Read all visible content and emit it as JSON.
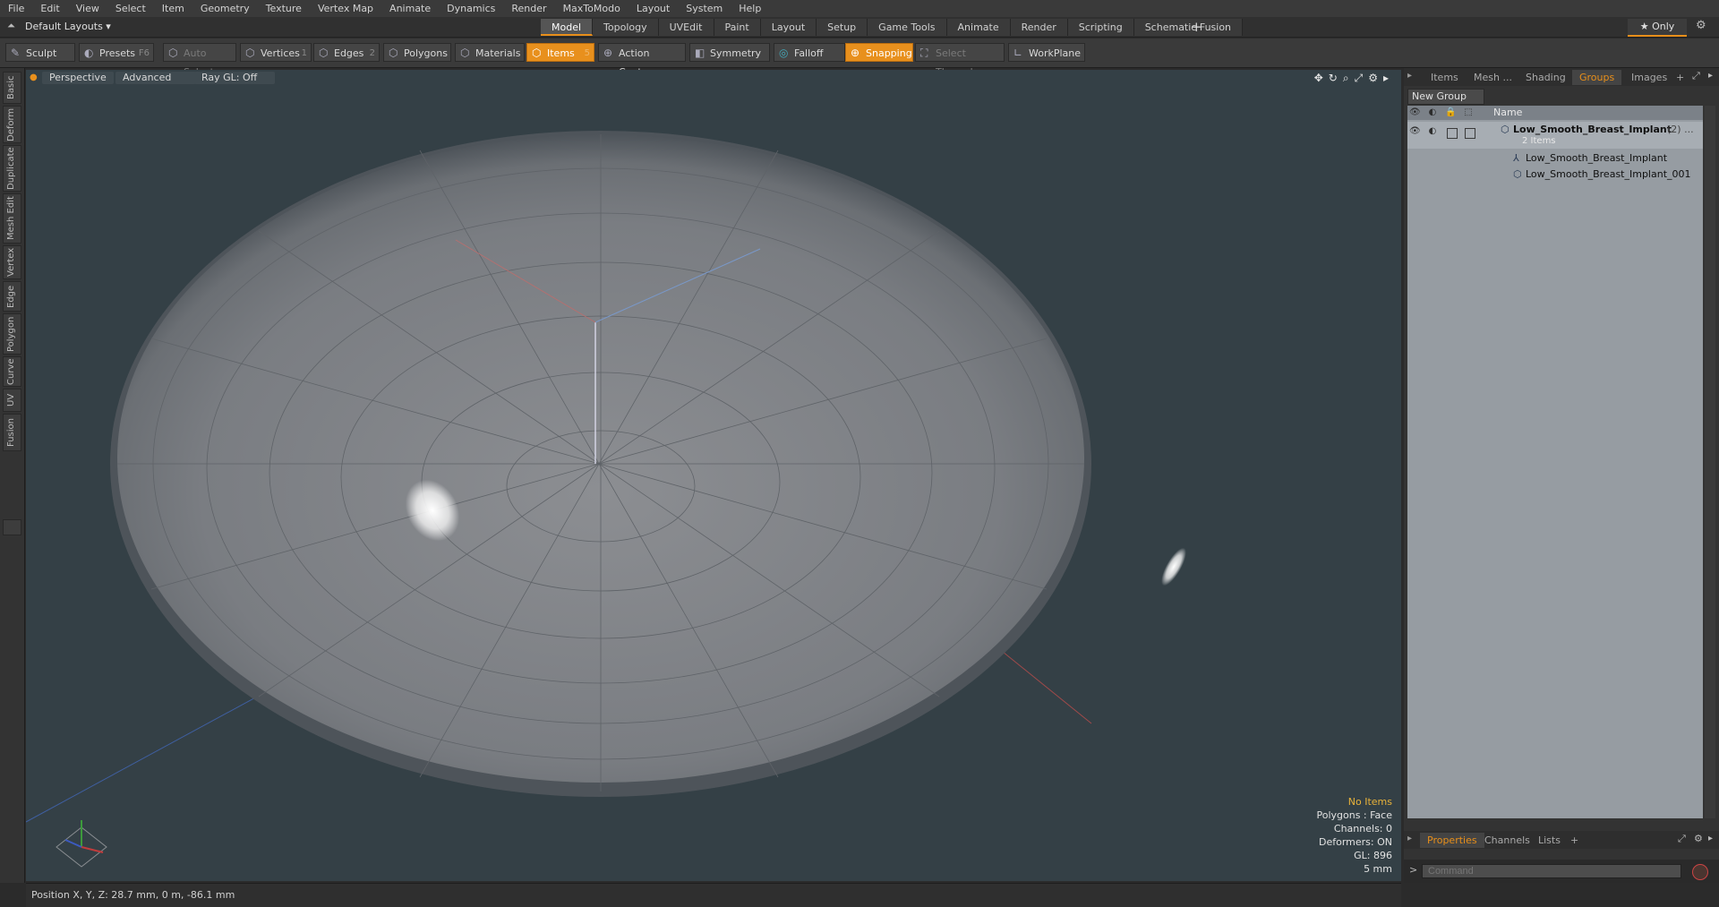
{
  "menu": [
    "File",
    "Edit",
    "View",
    "Select",
    "Item",
    "Geometry",
    "Texture",
    "Vertex Map",
    "Animate",
    "Dynamics",
    "Render",
    "MaxToModo",
    "Layout",
    "System",
    "Help"
  ],
  "layout_selector": "Default Layouts ▾",
  "tabs": [
    {
      "label": "Model",
      "active": true
    },
    {
      "label": "Topology",
      "active": false
    },
    {
      "label": "UVEdit",
      "active": false
    },
    {
      "label": "Paint",
      "active": false
    },
    {
      "label": "Layout",
      "active": false
    },
    {
      "label": "Setup",
      "active": false
    },
    {
      "label": "Game Tools",
      "active": false
    },
    {
      "label": "Animate",
      "active": false
    },
    {
      "label": "Render",
      "active": false
    },
    {
      "label": "Scripting",
      "active": false
    },
    {
      "label": "Schematic Fusion",
      "active": false
    }
  ],
  "add_tab": "+",
  "only_label": "★ Only",
  "toolbar": {
    "sculpt": "Sculpt",
    "presets": "Presets",
    "presets_key": "F6",
    "auto_select": "Auto Select",
    "vertices": "Vertices",
    "vertices_key": "1",
    "edges": "Edges",
    "edges_key": "2",
    "polygons": "Polygons",
    "materials": "Materials",
    "items": "Items",
    "items_key": "5",
    "action_center": "Action Center",
    "symmetry": "Symmetry",
    "falloff": "Falloff",
    "snapping": "Snapping",
    "select_through": "Select Through",
    "workplane": "WorkPlane"
  },
  "left_tabs": [
    "Basic",
    "Deform",
    "Duplicate",
    "Mesh Edit",
    "Vertex",
    "Edge",
    "Polygon",
    "Curve",
    "UV",
    "Fusion"
  ],
  "viewport": {
    "perspective": "Perspective",
    "advanced": "Advanced",
    "raygl": "Ray GL: Off",
    "info": {
      "no_items": "No Items",
      "polygons": "Polygons : Face",
      "channels": "Channels: 0",
      "deformers": "Deformers: ON",
      "gl": "GL: 896",
      "scale": "5 mm"
    }
  },
  "status": {
    "position": "Position X, Y, Z:   28.7 mm, 0 m, -86.1 mm"
  },
  "right_panel": {
    "tabs": [
      {
        "label": "Items",
        "active": false
      },
      {
        "label": "Mesh ...",
        "active": false
      },
      {
        "label": "Shading",
        "active": false
      },
      {
        "label": "Groups",
        "active": true
      },
      {
        "label": "Images",
        "active": false
      }
    ],
    "add": "+",
    "new_group": "New Group",
    "name_col": "Name",
    "tree": [
      {
        "name": "Low_Smooth_Breast_Implant",
        "suffix": "(2) ...",
        "sub": "2 Items"
      },
      {
        "name": "Low_Smooth_Breast_Implant"
      },
      {
        "name": "Low_Smooth_Breast_Implant_001"
      }
    ],
    "bottom_tabs": [
      {
        "label": "Properties",
        "active": true
      },
      {
        "label": "Channels",
        "active": false
      },
      {
        "label": "Lists",
        "active": false
      }
    ],
    "bottom_add": "+",
    "command_placeholder": "Command"
  },
  "colors": {
    "accent": "#e88f1a",
    "viewport_bg": "#344046",
    "panel_list": "#969ca2"
  }
}
